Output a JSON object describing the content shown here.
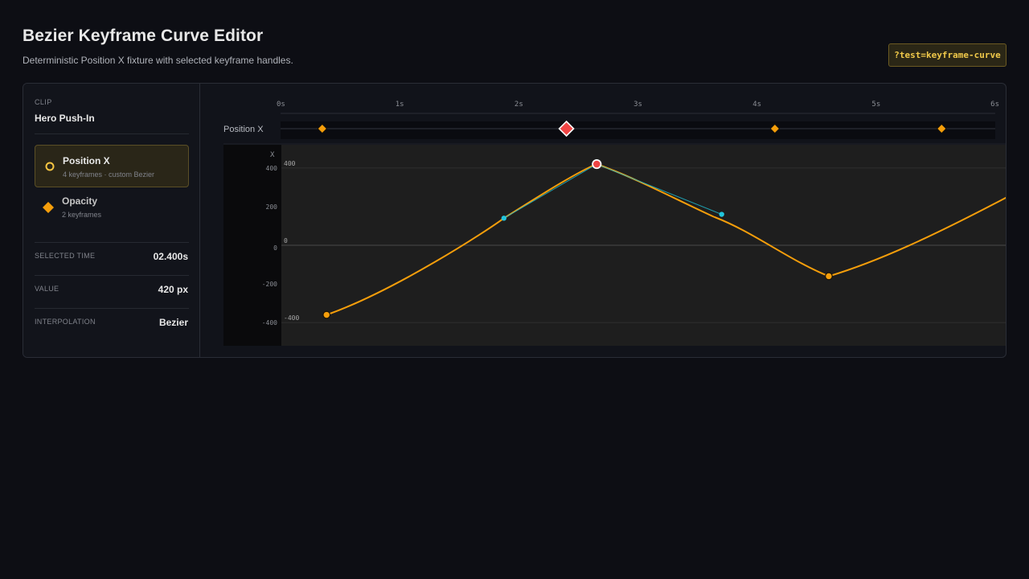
{
  "header": {
    "title": "Bezier Keyframe Curve Editor",
    "subtitle": "Deterministic Position X fixture with selected keyframe handles.",
    "test_badge": "?test=keyframe-curve"
  },
  "sidebar": {
    "clip_caption": "CLIP",
    "clip_name": "Hero Push-In",
    "tracks": [
      {
        "name": "Position X",
        "meta": "4 keyframes · custom Bezier",
        "icon": "circle-outline-icon",
        "active": true
      },
      {
        "name": "Opacity",
        "meta": "2 keyframes",
        "icon": "diamond-icon",
        "active": false
      }
    ],
    "properties": [
      {
        "label": "SELECTED TIME",
        "value": "02.400s"
      },
      {
        "label": "VALUE",
        "value": "420 px"
      },
      {
        "label": "INTERPOLATION",
        "value": "Bezier"
      }
    ]
  },
  "timeline": {
    "track_label": "Position X",
    "time_ticks": [
      "0s",
      "1s",
      "2s",
      "3s",
      "4s",
      "5s",
      "6s"
    ],
    "duration_s": 6,
    "keyframe_times_s": [
      0.35,
      2.4,
      4.15,
      5.55
    ],
    "selected_index": 1
  },
  "graph": {
    "axis_label": "X",
    "y_ticks": [
      "400",
      "200",
      "0",
      "-200",
      "-400"
    ],
    "ref_labels": [
      "400",
      "0",
      "-400"
    ],
    "y_range": [
      -520,
      520
    ]
  },
  "chart_data": {
    "type": "line",
    "series": [
      {
        "keyframes": [
          {
            "t": 0.38,
            "v": -360
          },
          {
            "t": 2.65,
            "v": 420
          },
          {
            "t": 4.6,
            "v": -160
          },
          {
            "t": 6.1,
            "v": 250
          }
        ]
      }
    ],
    "handles": [
      {
        "t": 1.87,
        "v": 140
      },
      {
        "t": 3.7,
        "v": 160
      }
    ],
    "selected_keyframe": 1,
    "xlim": [
      0,
      6.1
    ],
    "ylim": [
      -520,
      520
    ]
  },
  "colors": {
    "accent": "#f59e0b",
    "selected": "#ef4444",
    "handle": "#22c5dc",
    "badge_text": "#f0c94a",
    "active_track_icon": "#f5c542"
  }
}
